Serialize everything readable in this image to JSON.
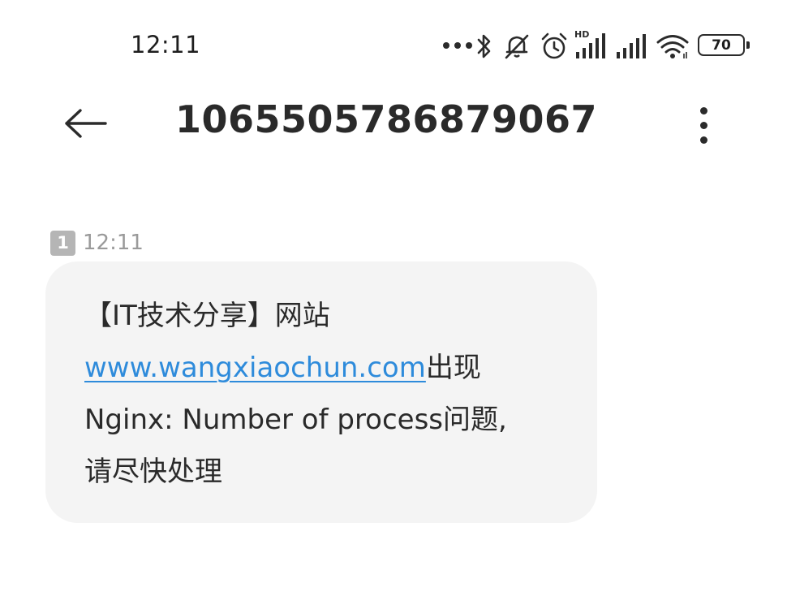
{
  "status_bar": {
    "time": "12:11",
    "battery": "70",
    "signal_tag": "HD",
    "icons": [
      "dots-icon",
      "bluetooth-icon",
      "mute-icon",
      "alarm-icon",
      "hd-signal-icon",
      "signal-icon",
      "wifi-icon",
      "battery-icon"
    ]
  },
  "header": {
    "title": "1065505786879067",
    "back_icon": "arrow-left-icon",
    "more_icon": "more-vert-icon"
  },
  "message": {
    "sim": "1",
    "time": "12:11",
    "text_part1": "【IT技术分享】网站",
    "link": "www.wangxiaochun.com",
    "text_part2": "出现",
    "text_part3": "Nginx: Number of process问题,",
    "text_part4": "请尽快处理"
  },
  "colors": {
    "background": "#ffffff",
    "bubble": "#f4f4f4",
    "link": "#2e8bdb",
    "text": "#2a2a2a",
    "muted": "#9a9a9a",
    "sim_badge": "#b5b5b5"
  }
}
